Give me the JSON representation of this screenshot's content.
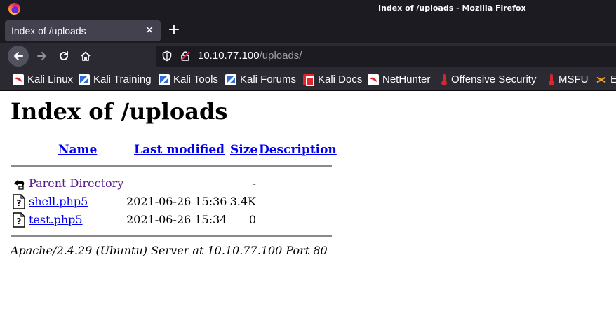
{
  "window": {
    "title": "Index of /uploads - Mozilla Firefox"
  },
  "tab": {
    "label": "Index of /uploads",
    "close_glyph": "✕",
    "new_tab_glyph": "+"
  },
  "urlbar": {
    "host": "10.10.77.100",
    "path": "/uploads/"
  },
  "bookmarks": [
    {
      "label": "Kali Linux",
      "icon": "kali-dragon-icon"
    },
    {
      "label": "Kali Training",
      "icon": "kali-training-icon"
    },
    {
      "label": "Kali Tools",
      "icon": "kali-tools-icon"
    },
    {
      "label": "Kali Forums",
      "icon": "kali-forums-icon"
    },
    {
      "label": "Kali Docs",
      "icon": "kali-docs-icon"
    },
    {
      "label": "NetHunter",
      "icon": "nethunter-icon"
    },
    {
      "label": "Offensive Security",
      "icon": "offsec-icon"
    },
    {
      "label": "MSFU",
      "icon": "msfu-icon"
    },
    {
      "label": "E",
      "icon": "exploit-db-icon"
    }
  ],
  "page": {
    "heading": "Index of /uploads",
    "columns": {
      "name": "Name",
      "last_modified": "Last modified",
      "size": "Size",
      "description": "Description"
    },
    "rows": [
      {
        "name": "Parent Directory",
        "date": "",
        "size": "-",
        "desc": "",
        "icon": "back-arrow-icon"
      },
      {
        "name": "shell.php5",
        "date": "2021-06-26 15:36",
        "size": "3.4K",
        "desc": "",
        "icon": "unknown-file-icon"
      },
      {
        "name": "test.php5",
        "date": "2021-06-26 15:34",
        "size": "0",
        "desc": "",
        "icon": "unknown-file-icon"
      }
    ],
    "address": "Apache/2.4.29 (Ubuntu) Server at 10.10.77.100 Port 80"
  },
  "colors": {
    "chrome_dark": "#1c1b22",
    "toolbar": "#2b2a33",
    "link": "#0000ee",
    "visited_link": "#551a8b"
  }
}
